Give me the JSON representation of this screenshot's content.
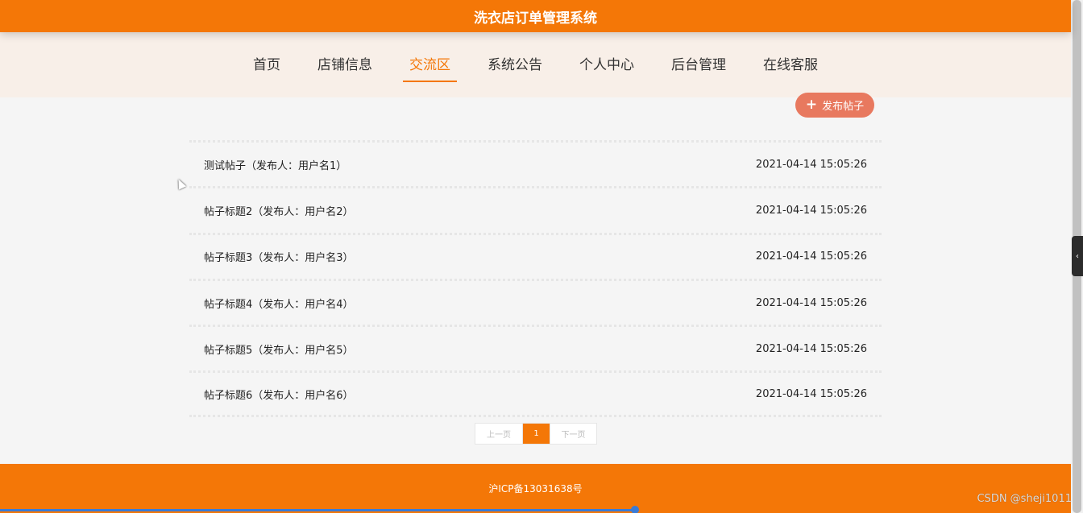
{
  "header": {
    "title": "洗衣店订单管理系统"
  },
  "nav": {
    "items": [
      {
        "label": "首页"
      },
      {
        "label": "店铺信息"
      },
      {
        "label": "交流区"
      },
      {
        "label": "系统公告"
      },
      {
        "label": "个人中心"
      },
      {
        "label": "后台管理"
      },
      {
        "label": "在线客服"
      }
    ],
    "active": "交流区"
  },
  "actions": {
    "post_label": "发布帖子",
    "post_icon": "plus-icon"
  },
  "posts": [
    {
      "title": "测试帖子（发布人：用户名1）",
      "time": "2021-04-14 15:05:26"
    },
    {
      "title": "帖子标题2（发布人：用户名2）",
      "time": "2021-04-14 15:05:26"
    },
    {
      "title": "帖子标题3（发布人：用户名3）",
      "time": "2021-04-14 15:05:26"
    },
    {
      "title": "帖子标题4（发布人：用户名4）",
      "time": "2021-04-14 15:05:26"
    },
    {
      "title": "帖子标题5（发布人：用户名5）",
      "time": "2021-04-14 15:05:26"
    },
    {
      "title": "帖子标题6（发布人：用户名6）",
      "time": "2021-04-14 15:05:26"
    }
  ],
  "pagination": {
    "prev": "上一页",
    "current": "1",
    "next": "下一页"
  },
  "footer": {
    "text": "沪ICP备13031638号"
  },
  "watermark": "CSDN @sheji1011",
  "colors": {
    "accent": "#f47707",
    "nav_bg": "#f8efe8",
    "post_button": "#e8795f"
  }
}
